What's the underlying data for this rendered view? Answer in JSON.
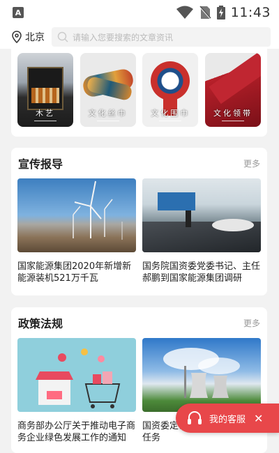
{
  "status_bar": {
    "time": "11:43",
    "app_badge": "A"
  },
  "location": {
    "city": "北京",
    "icon": "map-pin-icon"
  },
  "search": {
    "placeholder": "请输入您要搜索的文章资讯",
    "icon": "search-icon"
  },
  "categories": [
    {
      "label": "木艺"
    },
    {
      "label": "文化丝巾"
    },
    {
      "label": "文化围巾"
    },
    {
      "label": "文化领带"
    }
  ],
  "sections": [
    {
      "title": "宣传报导",
      "more": "更多",
      "items": [
        {
          "title": "国家能源集团2020年新增新能源装机521万千瓦"
        },
        {
          "title": "国务院国资委党委书记、主任郝鹏到国家能源集团调研"
        }
      ]
    },
    {
      "title": "政策法规",
      "more": "更多",
      "items": [
        {
          "title": "商务部办公厅关于推动电子商务企业绿色发展工作的通知"
        },
        {
          "title": "国资委定调国企改革六大重点任务"
        }
      ]
    }
  ],
  "service_button": {
    "label": "我的客服",
    "close": "✕"
  },
  "colors": {
    "accent": "#e8474a",
    "background": "#f2f2f2"
  }
}
